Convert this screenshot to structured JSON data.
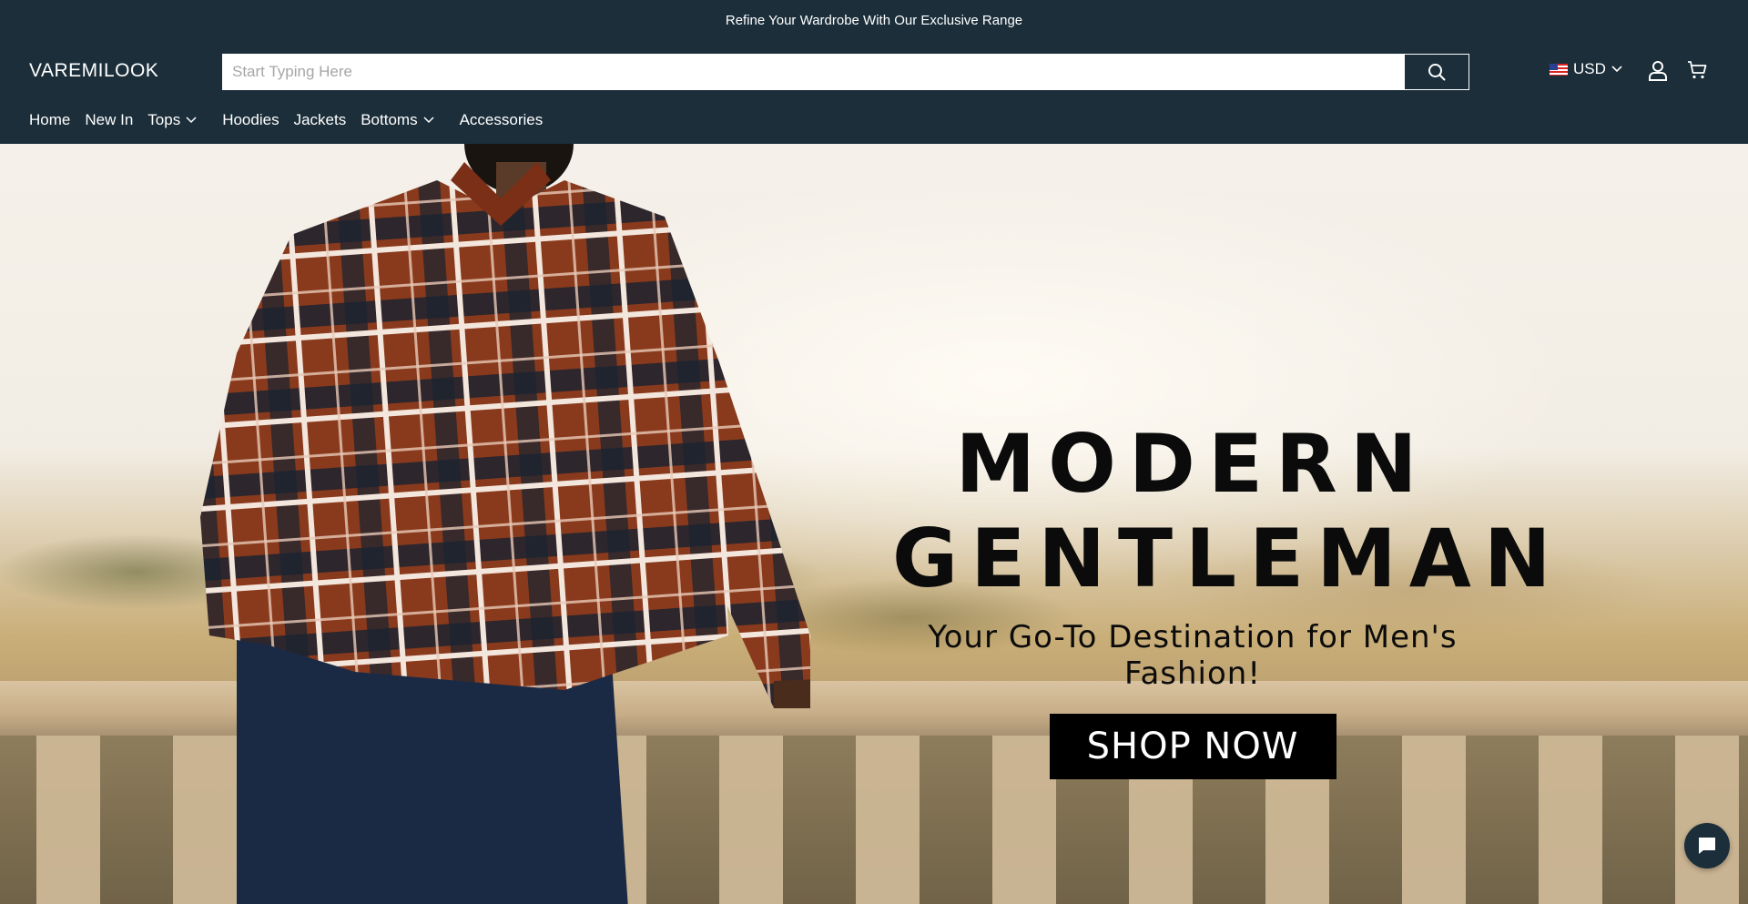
{
  "announcement": {
    "text": "Refine Your Wardrobe With Our Exclusive Range"
  },
  "header": {
    "logo": "VAREMILOOK",
    "search": {
      "placeholder": "Start Typing Here",
      "value": ""
    },
    "currency": {
      "code": "USD",
      "flag": "us-flag-icon"
    },
    "icons": [
      "search-icon",
      "user-icon",
      "cart-icon",
      "chevron-down-icon"
    ]
  },
  "nav": {
    "items": [
      {
        "label": "Home"
      },
      {
        "label": "New In"
      },
      {
        "label": "Tops"
      },
      {
        "label": "Hoodies"
      },
      {
        "label": "Jackets"
      },
      {
        "label": "Bottoms"
      },
      {
        "label": "Accessories"
      }
    ]
  },
  "hero": {
    "title_line1": "MODERN",
    "title_line2": "GENTLEMAN",
    "subtitle": "Your Go-To Destination for Men's Fashion!",
    "cta": "SHOP NOW"
  },
  "colors": {
    "header_bg": "#1b2e3a",
    "cta_bg": "#000000"
  }
}
